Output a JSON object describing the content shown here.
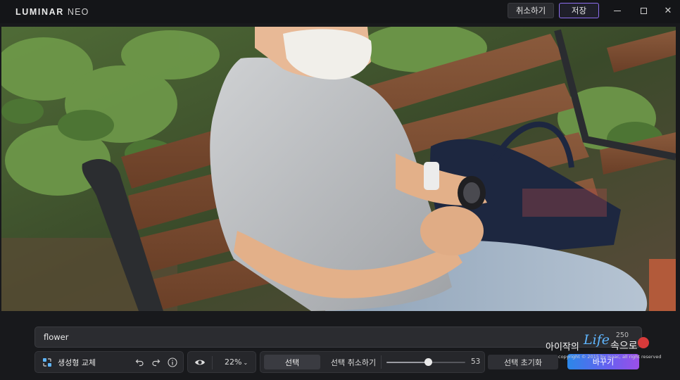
{
  "titlebar": {
    "logo_main": "LUMINAR",
    "logo_sub": "NEO",
    "cancel_label": "취소하기",
    "save_label": "저장"
  },
  "prompt": {
    "value": "flower",
    "char_count": "250"
  },
  "toolbar": {
    "tool_label": "생성형 교체",
    "zoom": "22%",
    "select_label": "선택",
    "deselect_label": "선택 취소하기",
    "brush_value": "53",
    "brush_fraction": 0.53,
    "reset_label": "선택 초기화",
    "apply_label": "바꾸기"
  },
  "watermark": {
    "text_a": "아이작의",
    "text_life": "Life",
    "text_b": "속으로",
    "copyright": "copyright © 2015 by isaac, all right reserved"
  },
  "colors": {
    "accent": "#8d6ff0",
    "apply_gradient_start": "#2b87e8",
    "apply_gradient_end": "#9c4fe8"
  },
  "icons": {
    "undo": "undo-icon",
    "redo": "redo-icon",
    "info": "info-icon",
    "eye": "eye-icon",
    "tool": "generative-swap-icon"
  }
}
